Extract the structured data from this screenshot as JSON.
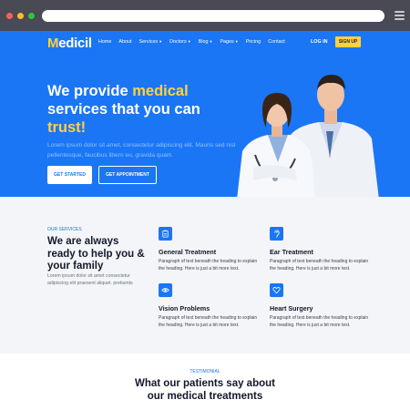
{
  "brand": {
    "logo_first": "M",
    "logo_rest": "edicil",
    "primary_color": "#1a76f5",
    "accent_color": "#ffd23c"
  },
  "nav": {
    "items": [
      {
        "label": "Home",
        "dropdown": false
      },
      {
        "label": "About",
        "dropdown": false
      },
      {
        "label": "Services",
        "dropdown": true
      },
      {
        "label": "Doctors",
        "dropdown": true
      },
      {
        "label": "Blog",
        "dropdown": true
      },
      {
        "label": "Pages",
        "dropdown": true
      },
      {
        "label": "Pricing",
        "dropdown": false
      },
      {
        "label": "Contact",
        "dropdown": false
      }
    ],
    "login_label": "LOG IN",
    "signup_label": "SIGN UP"
  },
  "hero": {
    "title_part1": "We provide ",
    "title_highlight1": "medical",
    "title_part2": " services that you can ",
    "title_highlight2": "trust!",
    "subtitle": "Lorem ipsum dolor sit amet, consectetur adipiscing elit. Mauris sed nisl pellentesque, faucibus libero eu, gravida quam.",
    "btn_started": "GET STARTED",
    "btn_appointment": "GET APPOINTMENT"
  },
  "services": {
    "label": "OUR SERVICES",
    "title": "We are always ready to help you & your family",
    "description": "Lorem ipsum dolor sit amet consectetur adipiscing elit praesent aliquet. pretiumts",
    "cards": [
      {
        "icon": "clipboard-icon",
        "title": "General Treatment",
        "text": "Paragraph of text beneath the heading to explain the heading. Here is just a bit more text."
      },
      {
        "icon": "ear-icon",
        "title": "Ear Treatment",
        "text": "Paragraph of text beneath the heading to explain the heading. Here is just a bit more text."
      },
      {
        "icon": "eye-icon",
        "title": "Vision Problems",
        "text": "Paragraph of text beneath the heading to explain the heading. Here is just a bit more text."
      },
      {
        "icon": "heart-icon",
        "title": "Heart Surgery",
        "text": "Paragraph of text beneath the heading to explain the heading. Here is just a bit more text."
      }
    ]
  },
  "testimonial": {
    "label": "TESTIMONIAL",
    "title": "What our patients say about our medical treatments"
  }
}
